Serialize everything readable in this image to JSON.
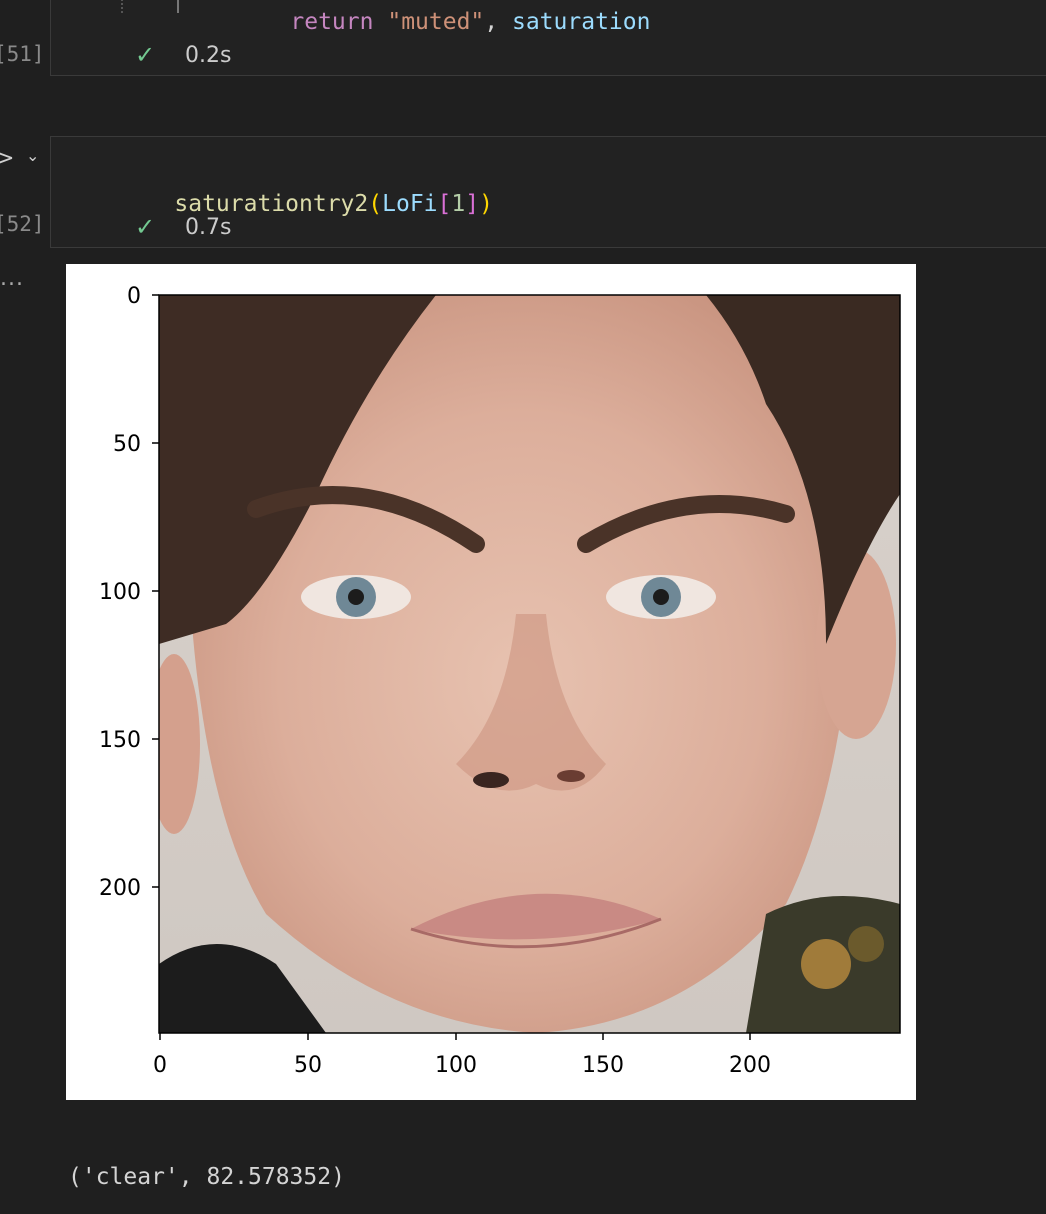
{
  "cell51": {
    "exec_count": "[51]",
    "code": {
      "kw": "return",
      "str": "\"muted\"",
      "sep": ", ",
      "var": "saturation"
    },
    "status_time": "0.2s"
  },
  "cell52": {
    "exec_count": "[52]",
    "code": {
      "fn": "saturationtry2",
      "open": "(",
      "var": "LoFi",
      "bo": "[",
      "idx": "1",
      "bc": "]",
      "close": ")"
    },
    "status_time": "0.7s"
  },
  "output": {
    "ellipsis": "...",
    "text": "('clear', 82.578352)"
  },
  "figure": {
    "image_description": "",
    "icons": {
      "check": "check-icon",
      "run": "chevron-right-icon",
      "collapse": "chevron-down-icon"
    }
  },
  "chart_data": {
    "type": "image",
    "xticks": [
      "0",
      "50",
      "100",
      "150",
      "200"
    ],
    "yticks": [
      "0",
      "50",
      "100",
      "150",
      "200"
    ],
    "xlim": [
      0,
      250
    ],
    "ylim": [
      250,
      0
    ]
  }
}
